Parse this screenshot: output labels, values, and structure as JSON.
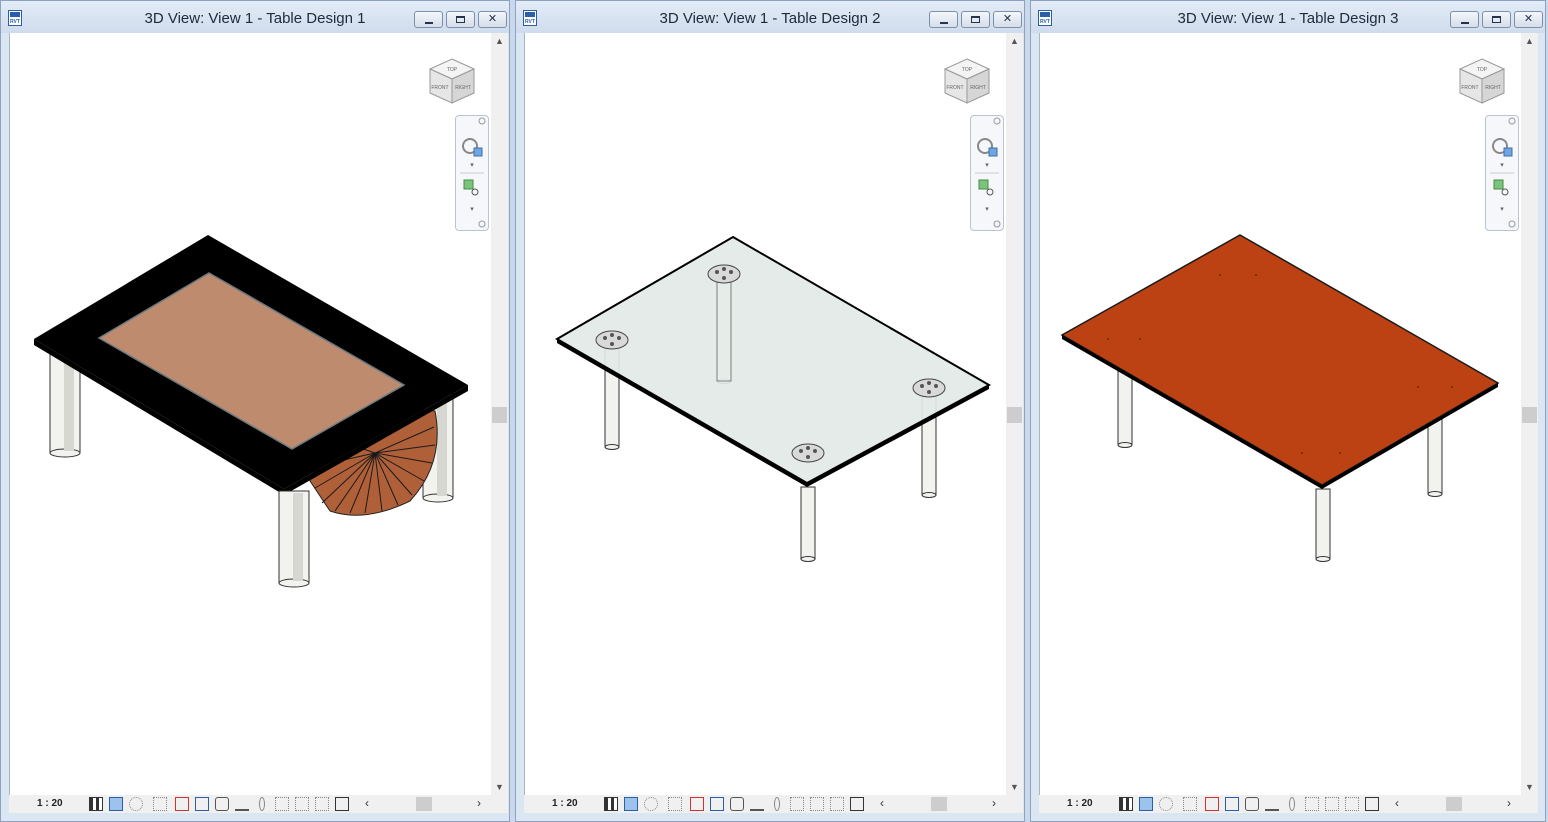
{
  "windows": [
    {
      "title": "3D View: View 1 - Table Design 1",
      "scale": "1 : 20",
      "design": "frame"
    },
    {
      "title": "3D View: View 1 - Table Design 2",
      "scale": "1 : 20",
      "design": "glass"
    },
    {
      "title": "3D View: View 1 - Table Design 3",
      "scale": "1 : 20",
      "design": "wood"
    }
  ],
  "viewcube": {
    "top_label": "TOP",
    "front_label": "FRONT",
    "right_label": "RIGHT"
  },
  "colors": {
    "frame_black": "#000000",
    "inset_wood": "#bf8b6e",
    "drum": "#b06038",
    "glass": "#e2e9e6",
    "wood_top": "#bc4214",
    "leg": "#f2f2ee"
  },
  "status_icons": [
    "detail-level-icon",
    "visual-style-icon",
    "sun-path-icon",
    "shadows-icon",
    "crop-view-icon",
    "show-crop-icon",
    "temp-hide-icon",
    "reveal-hidden-icon",
    "worksharing-icon",
    "design-options-icon",
    "highlight-icon",
    "analytical-icon",
    "constraints-icon",
    "temporary-view-icon",
    "lock-view-icon"
  ]
}
